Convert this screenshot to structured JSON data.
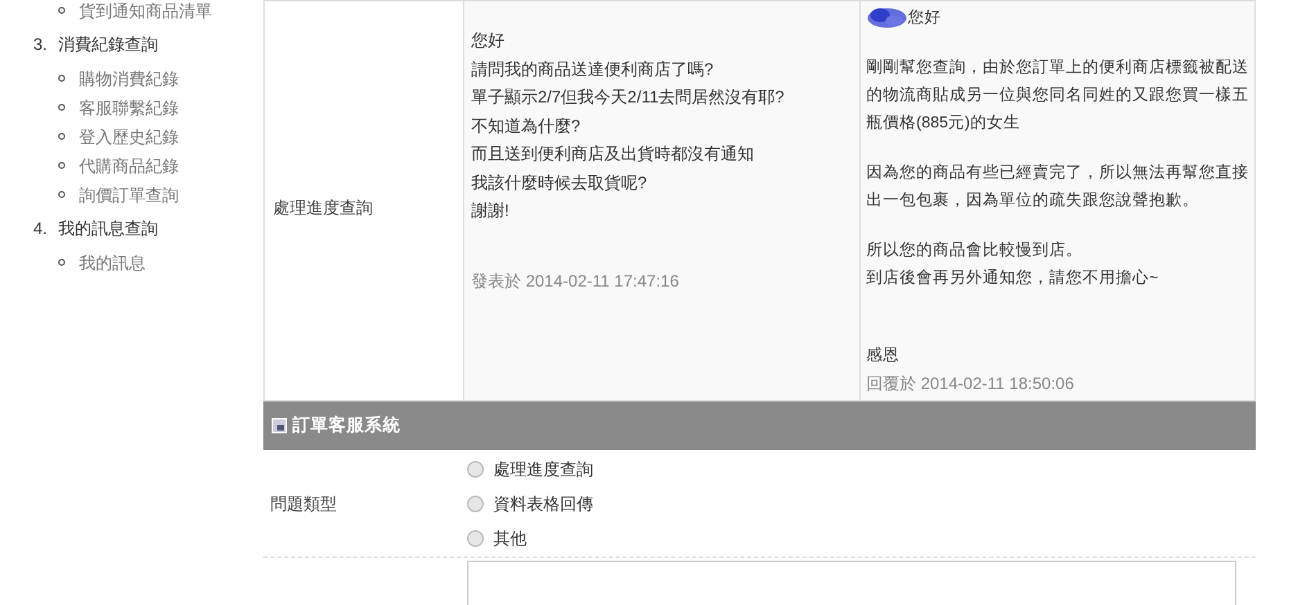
{
  "sidebar": {
    "items": [
      {
        "label": "貨到通知商品清單"
      }
    ],
    "sections": [
      {
        "number": "3.",
        "title": "消費紀錄查詢",
        "children": [
          {
            "label": "購物消費紀錄"
          },
          {
            "label": "客服聯繫紀錄"
          },
          {
            "label": "登入歷史紀錄"
          },
          {
            "label": "代購商品紀錄"
          },
          {
            "label": "詢價訂單查詢"
          }
        ]
      },
      {
        "number": "4.",
        "title": "我的訊息查詢",
        "children": [
          {
            "label": "我的訊息"
          }
        ]
      }
    ]
  },
  "messages": {
    "rows": [
      {
        "label": "處理進度查詢",
        "question": {
          "lines": [
            "您好",
            "請問我的商品送達便利商店了嗎?",
            "單子顯示2/7但我今天2/11去問居然沒有耶?",
            "不知道為什麼?",
            "而且送到便利商店及出貨時都沒有通知",
            "我該什麼時候去取貨呢?",
            "謝謝!"
          ],
          "posted": "發表於 2014-02-11 17:47:16"
        },
        "reply": {
          "greeting": "您好",
          "paragraphs": [
            [
              "剛剛幫您查詢，由於您訂單上的便利商店標籤被配送的物流商貼成另一位與您同名同姓的又跟您買一樣五瓶價格(885元)的女生"
            ],
            [
              "因為您的商品有些已經賣完了，所以無法再幫您直接出一包包裹，因為單位的疏失跟您說聲抱歉。"
            ],
            [
              "所以您的商品會比較慢到店。",
              "到店後會再另外通知您，請您不用擔心~"
            ]
          ],
          "signature": "感恩",
          "replied": "回覆於 2014-02-11 18:50:06"
        }
      }
    ]
  },
  "form": {
    "title": "訂單客服系統",
    "question_type": {
      "label": "問題類型",
      "options": [
        {
          "label": "處理進度查詢",
          "selected": false
        },
        {
          "label": "資料表格回傳",
          "selected": false
        },
        {
          "label": "其他",
          "selected": false
        }
      ]
    }
  }
}
